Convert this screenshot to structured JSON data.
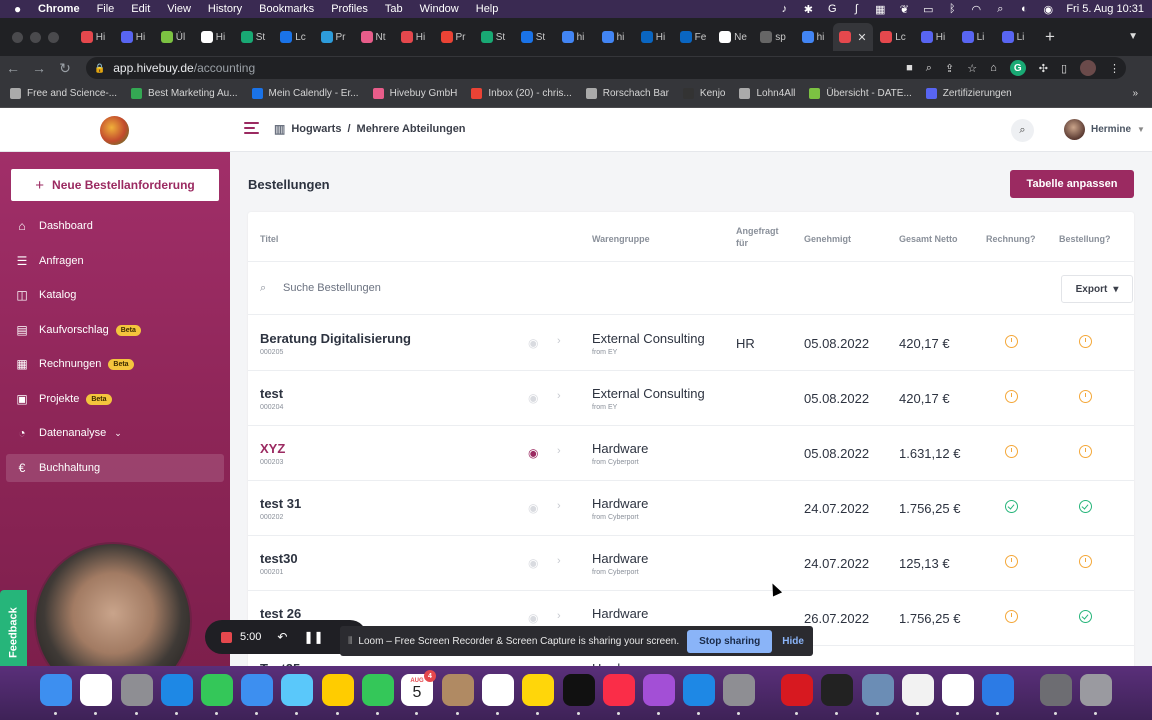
{
  "menubar": {
    "items": [
      "Chrome",
      "File",
      "Edit",
      "View",
      "History",
      "Bookmarks",
      "Profiles",
      "Tab",
      "Window",
      "Help"
    ],
    "clock": "Fri 5. Aug  10:31"
  },
  "tabs": [
    {
      "label": "Hi",
      "color": "#e5484d"
    },
    {
      "label": "Hi",
      "color": "#5865f2"
    },
    {
      "label": "Ül",
      "color": "#7cc242"
    },
    {
      "label": "Hi",
      "color": "#ffffff"
    },
    {
      "label": "St",
      "color": "#19a974"
    },
    {
      "label": "Lc",
      "color": "#1a73e8"
    },
    {
      "label": "Pr",
      "color": "#2d9cdb"
    },
    {
      "label": "Nt",
      "color": "#e85d8a"
    },
    {
      "label": "Hi",
      "color": "#e5484d"
    },
    {
      "label": "Pr",
      "color": "#ea4335"
    },
    {
      "label": "St",
      "color": "#19a974"
    },
    {
      "label": "St",
      "color": "#1a73e8"
    },
    {
      "label": "hi",
      "color": "#4285f4"
    },
    {
      "label": "hi",
      "color": "#4285f4"
    },
    {
      "label": "Hi",
      "color": "#0a66c2"
    },
    {
      "label": "Fe",
      "color": "#0a66c2"
    },
    {
      "label": "Ne",
      "color": "#ffffff"
    },
    {
      "label": "sp",
      "color": "#666666"
    },
    {
      "label": "hi",
      "color": "#4285f4"
    },
    {
      "label": "",
      "color": "#e5484d"
    },
    {
      "label": "Lc",
      "color": "#e5484d"
    },
    {
      "label": "Hi",
      "color": "#5865f2"
    },
    {
      "label": "Li",
      "color": "#5865f2"
    },
    {
      "label": "Li",
      "color": "#5865f2"
    }
  ],
  "address": {
    "host": "app.hivebuy.de",
    "path": "/accounting"
  },
  "bookmarks": [
    {
      "label": "Free and Science-...",
      "color": "#aaaaaa"
    },
    {
      "label": "Best Marketing Au...",
      "color": "#34a853"
    },
    {
      "label": "Mein Calendly - Er...",
      "color": "#1a73e8"
    },
    {
      "label": "Hivebuy GmbH",
      "color": "#e85d8a"
    },
    {
      "label": "Inbox (20) - chris...",
      "color": "#ea4335"
    },
    {
      "label": "Rorschach Bar",
      "color": "#aaaaaa"
    },
    {
      "label": "Kenjo",
      "color": "#333333"
    },
    {
      "label": "Lohn4All",
      "color": "#aaaaaa"
    },
    {
      "label": "Übersicht - DATE...",
      "color": "#7cc242"
    },
    {
      "label": "Zertifizierungen",
      "color": "#5865f2"
    }
  ],
  "header": {
    "org": "Hogwarts",
    "separator": "/",
    "department": "Mehrere Abteilungen",
    "user": "Hermine"
  },
  "sidebar": {
    "new_request": "Neue Bestellanforderung",
    "items": [
      {
        "label": "Dashboard",
        "icon": "home-icon",
        "glyph": "⌂",
        "beta": ""
      },
      {
        "label": "Anfragen",
        "icon": "sliders-icon",
        "glyph": "☰",
        "beta": ""
      },
      {
        "label": "Katalog",
        "icon": "bag-icon",
        "glyph": "◫",
        "beta": ""
      },
      {
        "label": "Kaufvorschlag",
        "icon": "clipboard-icon",
        "glyph": "▤",
        "beta": "Beta"
      },
      {
        "label": "Rechnungen",
        "icon": "receipt-icon",
        "glyph": "▦",
        "beta": "Beta"
      },
      {
        "label": "Projekte",
        "icon": "folder-icon",
        "glyph": "▣",
        "beta": "Beta"
      },
      {
        "label": "Datenanalyse",
        "icon": "chart-icon",
        "glyph": "◔",
        "beta": ""
      },
      {
        "label": "Buchhaltung",
        "icon": "euro-icon",
        "glyph": "€",
        "beta": ""
      }
    ],
    "feedback": "Feedback"
  },
  "main": {
    "title": "Bestellungen",
    "customize": "Tabelle anpassen",
    "search_placeholder": "Suche Bestellungen",
    "export": "Export",
    "columns": {
      "title": "Titel",
      "category": "Warengruppe",
      "requested_for_1": "Angefragt",
      "requested_for_2": "für",
      "approved": "Genehmigt",
      "total": "Gesamt Netto",
      "invoice": "Rechnung?",
      "order": "Bestellung?"
    },
    "rows": [
      {
        "title": "Beratung Digitalisierung",
        "id": "000205",
        "category": "External Consulting",
        "supplier": "from EY",
        "requested_for": "HR",
        "date": "05.08.2022",
        "amount": "420,17 €",
        "invoice": "pending",
        "order": "pending",
        "eye_active": false
      },
      {
        "title": "test",
        "id": "000204",
        "category": "External Consulting",
        "supplier": "from EY",
        "requested_for": "",
        "date": "05.08.2022",
        "amount": "420,17 €",
        "invoice": "pending",
        "order": "pending",
        "eye_active": false
      },
      {
        "title": "XYZ",
        "id": "000203",
        "category": "Hardware",
        "supplier": "from Cyberport",
        "requested_for": "",
        "date": "05.08.2022",
        "amount": "1.631,12 €",
        "invoice": "pending",
        "order": "pending",
        "eye_active": true
      },
      {
        "title": "test 31",
        "id": "000202",
        "category": "Hardware",
        "supplier": "from Cyberport",
        "requested_for": "",
        "date": "24.07.2022",
        "amount": "1.756,25 €",
        "invoice": "done",
        "order": "done",
        "eye_active": false
      },
      {
        "title": "test30",
        "id": "000201",
        "category": "Hardware",
        "supplier": "from Cyberport",
        "requested_for": "",
        "date": "24.07.2022",
        "amount": "125,13 €",
        "invoice": "pending",
        "order": "pending",
        "eye_active": false
      },
      {
        "title": "test 26",
        "id": "",
        "category": "Hardware",
        "supplier": "",
        "requested_for": "",
        "date": "26.07.2022",
        "amount": "1.756,25 €",
        "invoice": "pending",
        "order": "done",
        "eye_active": false
      },
      {
        "title": "Test25",
        "id": "",
        "category": "Hardware",
        "supplier": "",
        "requested_for": "",
        "date": "",
        "amount": "",
        "invoice": "",
        "order": "",
        "eye_active": false
      }
    ]
  },
  "loom": {
    "timer": "5:00",
    "message": "Loom – Free Screen Recorder & Screen Capture is sharing your screen.",
    "stop": "Stop sharing",
    "hide": "Hide"
  },
  "dock": {
    "calendar_month": "AUG",
    "calendar_day": "5",
    "calendar_badge": "4",
    "apps": [
      {
        "name": "finder",
        "color": "#3d8ff0"
      },
      {
        "name": "chrome",
        "color": "#ffffff"
      },
      {
        "name": "launchpad",
        "color": "#8e8e93"
      },
      {
        "name": "safari",
        "color": "#1e88e5"
      },
      {
        "name": "messages",
        "color": "#34c759"
      },
      {
        "name": "mail",
        "color": "#3d8ff0"
      },
      {
        "name": "maps",
        "color": "#5ac8fa"
      },
      {
        "name": "photos",
        "color": "#ffcc00"
      },
      {
        "name": "facetime",
        "color": "#34c759"
      },
      {
        "name": "calendar",
        "color": "#ffffff"
      },
      {
        "name": "contacts",
        "color": "#b08a63"
      },
      {
        "name": "reminders",
        "color": "#ffffff"
      },
      {
        "name": "notes",
        "color": "#ffd60a"
      },
      {
        "name": "appletv",
        "color": "#111111"
      },
      {
        "name": "music",
        "color": "#fa2d48"
      },
      {
        "name": "podcasts",
        "color": "#a34fd6"
      },
      {
        "name": "appstore",
        "color": "#1e88e5"
      },
      {
        "name": "settings",
        "color": "#8e8e93"
      },
      {
        "name": "acrobat",
        "color": "#d71920"
      },
      {
        "name": "vectorworks",
        "color": "#222222"
      },
      {
        "name": "preview",
        "color": "#6b8db5"
      },
      {
        "name": "textedit",
        "color": "#f2f2f2"
      },
      {
        "name": "slack",
        "color": "#ffffff"
      },
      {
        "name": "vpn",
        "color": "#2c7be5"
      },
      {
        "name": "downloads",
        "color": "#6d6d72"
      },
      {
        "name": "trash",
        "color": "#9a9aa0"
      }
    ]
  }
}
